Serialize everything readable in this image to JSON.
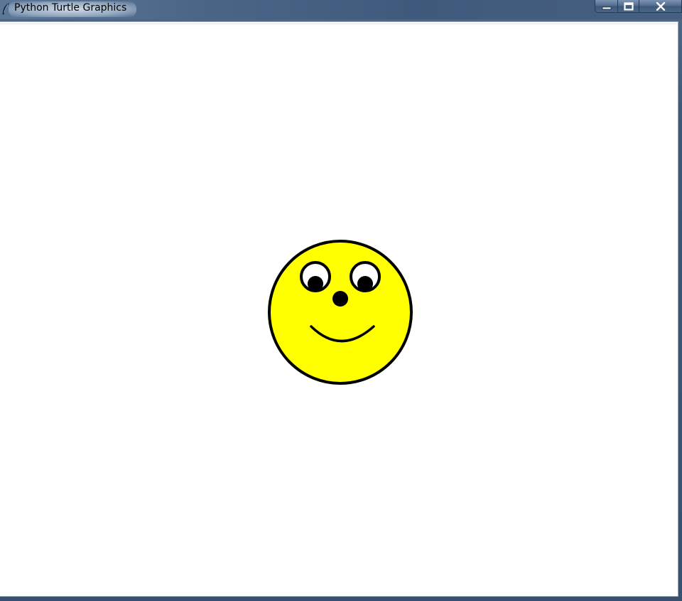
{
  "window": {
    "title": "Python Turtle Graphics"
  },
  "icons": {
    "app": "feather-icon",
    "minimize": "minimize-icon",
    "maximize": "maximize-icon",
    "close": "close-icon"
  },
  "colors": {
    "face_fill": "#ffff00",
    "outline": "#000000",
    "canvas_bg": "#ffffff",
    "eye_white": "#ffffff"
  }
}
